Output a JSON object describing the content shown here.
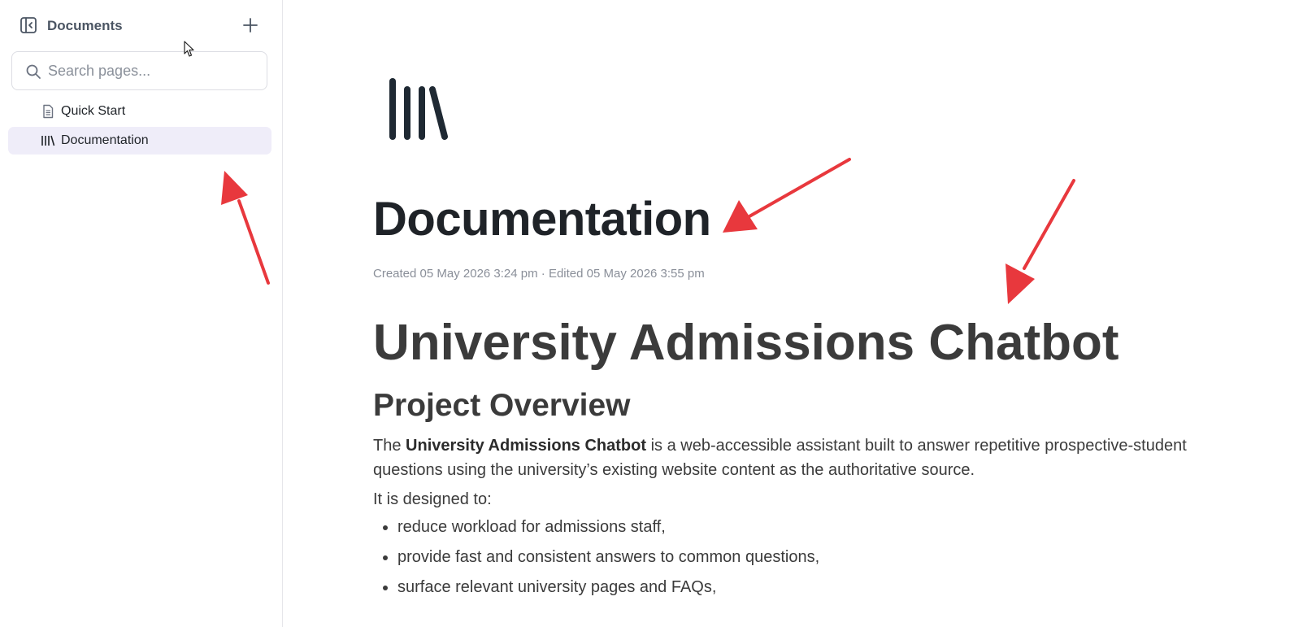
{
  "sidebar": {
    "title": "Documents",
    "search": {
      "placeholder": "Search pages...",
      "value": ""
    },
    "items": [
      {
        "label": "Quick Start",
        "icon": "page-icon",
        "active": false
      },
      {
        "label": "Documentation",
        "icon": "library-icon",
        "active": true
      }
    ]
  },
  "main": {
    "title": "Documentation",
    "meta": "Created 05 May 2026 3:24 pm · Edited 05 May 2026 3:55 pm",
    "h1": "University Admissions Chatbot",
    "h2": "Project Overview",
    "intro": {
      "pre": "The ",
      "bold": "University Admissions Chatbot",
      "post": " is a web-accessible assistant built to answer repetitive prospective-student questions using the university’s existing website content as the authoritative source."
    },
    "designed_to": "It is designed to:",
    "bullets": [
      "reduce workload for admissions staff,",
      "provide fast and consistent answers to common questions,",
      "surface relevant university pages and FAQs,"
    ]
  },
  "colors": {
    "active_bg": "#efedf9",
    "annotation_arrow": "#e8383d",
    "title_text": "#1f2328",
    "body_text": "#3b3b3b"
  }
}
